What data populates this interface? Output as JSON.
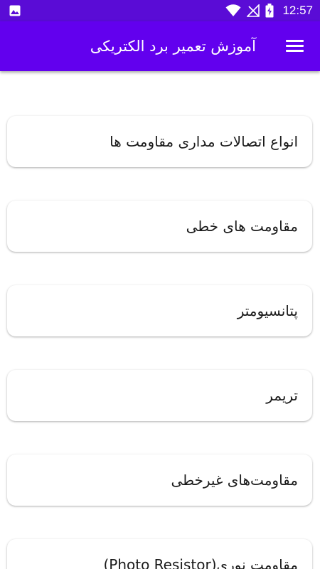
{
  "status_bar": {
    "time": "12:57",
    "icons": [
      "image-icon",
      "wifi-icon",
      "signal-off-icon",
      "battery-charging-icon"
    ]
  },
  "app_bar": {
    "title": "آموزش تعمیر برد الکتریکی",
    "menu_icon": "menu-icon"
  },
  "items": [
    {
      "label": "انواع اتصالات مداری مقاومت ها"
    },
    {
      "label": "مقاومت های خطی"
    },
    {
      "label": "پتانسیومتر"
    },
    {
      "label": "تریمر"
    },
    {
      "label": "مقاومت‌های غیرخطی"
    },
    {
      "label": "مقاومت نوری(Photo Resistor)"
    }
  ],
  "colors": {
    "status_bar": "#5a0cd6",
    "app_bar": "#6200ee",
    "card_bg": "#ffffff",
    "text": "#1a1a1a"
  }
}
